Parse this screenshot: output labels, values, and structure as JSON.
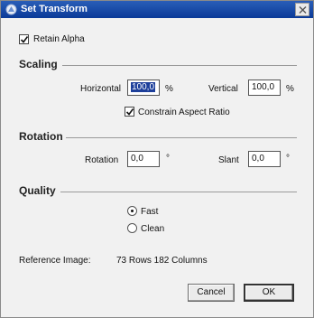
{
  "window": {
    "title": "Set Transform"
  },
  "options": {
    "retain_alpha_label": "Retain Alpha",
    "retain_alpha_checked": true
  },
  "scaling": {
    "section_title": "Scaling",
    "horizontal_label": "Horizontal",
    "horizontal_value": "100,0",
    "horizontal_unit": "%",
    "vertical_label": "Vertical",
    "vertical_value": "100,0",
    "vertical_unit": "%",
    "constrain_label": "Constrain Aspect Ratio",
    "constrain_checked": true
  },
  "rotation": {
    "section_title": "Rotation",
    "rotation_label": "Rotation",
    "rotation_value": "0,0",
    "rotation_unit": "°",
    "slant_label": "Slant",
    "slant_value": "0,0",
    "slant_unit": "°"
  },
  "quality": {
    "section_title": "Quality",
    "options": [
      {
        "label": "Fast",
        "selected": true
      },
      {
        "label": "Clean",
        "selected": false
      }
    ]
  },
  "reference": {
    "label": "Reference Image:",
    "value": "73 Rows 182 Columns"
  },
  "buttons": {
    "cancel_label": "Cancel",
    "ok_label": "OK"
  },
  "icons": {
    "app": "app-icon",
    "close": "close-icon",
    "check": "checkmark-icon"
  }
}
